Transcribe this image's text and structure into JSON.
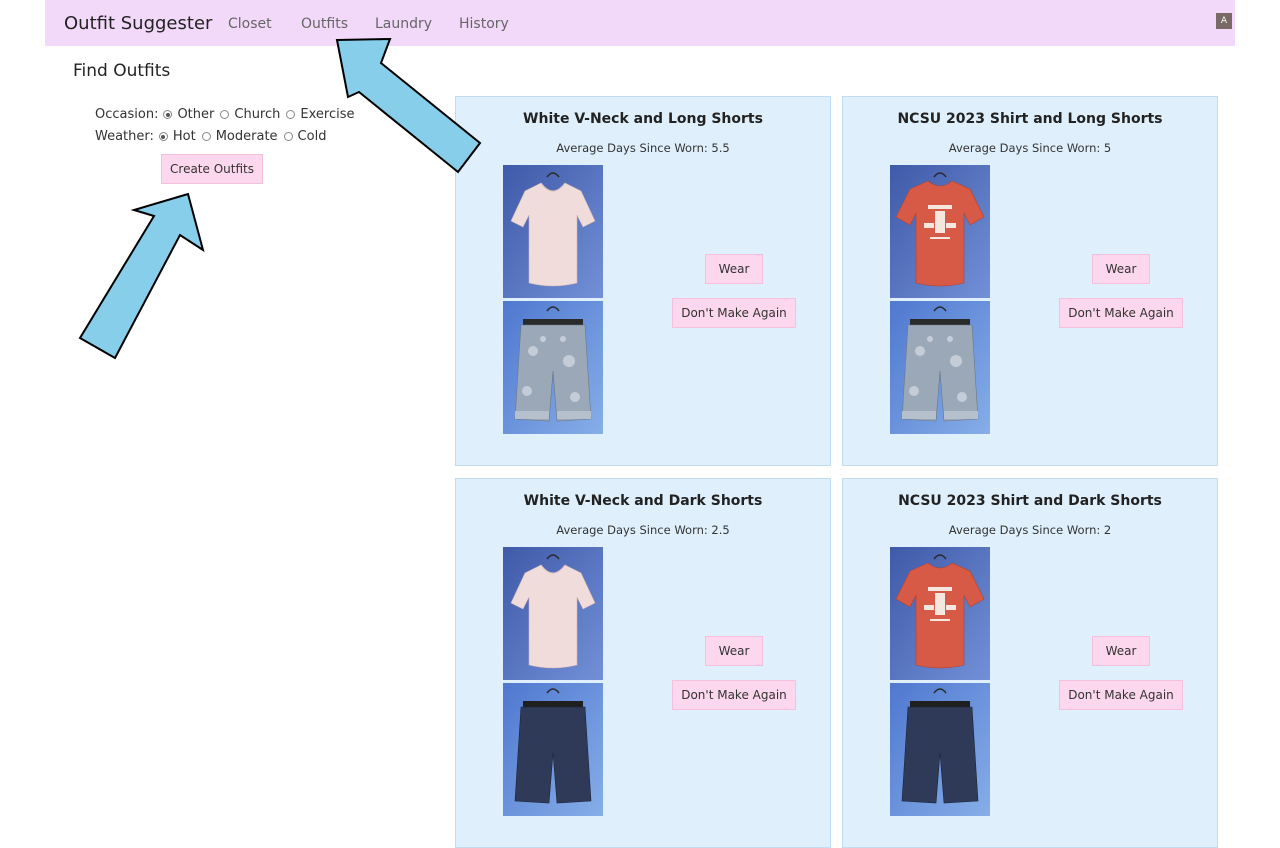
{
  "nav": {
    "brand": "Outfit Suggester",
    "links": [
      "Closet",
      "Outfits",
      "Laundry",
      "History"
    ],
    "avatar": "A"
  },
  "find": {
    "title": "Find Outfits",
    "occasion_label": "Occasion:",
    "occasion_options": [
      "Other",
      "Church",
      "Exercise"
    ],
    "occasion_selected": "Other",
    "weather_label": "Weather:",
    "weather_options": [
      "Hot",
      "Moderate",
      "Cold"
    ],
    "weather_selected": "Hot",
    "create_button": "Create Outfits"
  },
  "outfits": [
    {
      "title": "White V-Neck and Long Shorts",
      "avg_label": "Average Days Since Worn: 5.5",
      "top": "white-vneck",
      "bottom": "long-shorts"
    },
    {
      "title": "NCSU 2023 Shirt and Long Shorts",
      "avg_label": "Average Days Since Worn: 5",
      "top": "ncsu-shirt",
      "bottom": "long-shorts"
    },
    {
      "title": "White V-Neck and Dark Shorts",
      "avg_label": "Average Days Since Worn: 2.5",
      "top": "white-vneck",
      "bottom": "dark-shorts"
    },
    {
      "title": "NCSU 2023 Shirt and Dark Shorts",
      "avg_label": "Average Days Since Worn: 2",
      "top": "ncsu-shirt",
      "bottom": "dark-shorts"
    }
  ],
  "buttons": {
    "wear": "Wear",
    "dont_make_again": "Don't Make Again"
  },
  "colors": {
    "navbar": "#f3d9f9",
    "card": "#dff0fc",
    "button": "#fcd7ee",
    "arrow": "#87ceeb",
    "photo_bg": "#5a78c8"
  }
}
